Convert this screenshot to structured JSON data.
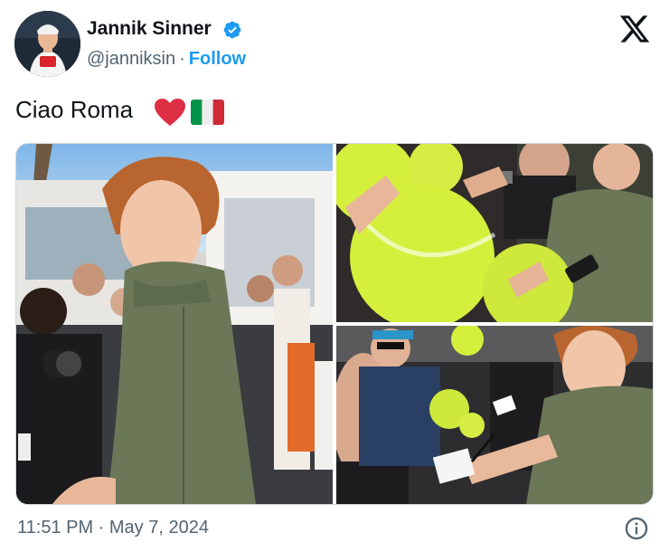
{
  "author": {
    "name": "Jannik Sinner",
    "handle": "@janniksin",
    "separator": "·",
    "follow_label": "Follow",
    "verified_icon": "verified-badge-icon"
  },
  "tweet": {
    "text": "Ciao Roma",
    "emojis": [
      "red-heart-emoji",
      "italy-flag-emoji"
    ]
  },
  "media": {
    "photo_count": 3
  },
  "footer": {
    "timestamp": "11:51 PM · May 7, 2024",
    "info_icon": "info-icon"
  },
  "brand": {
    "logo": "x-logo-icon"
  },
  "colors": {
    "link_blue": "#1d9bf0",
    "secondary_text": "#536471",
    "primary_text": "#0f1419",
    "border": "#cfd9de",
    "jacket_green": "#6b7757",
    "tennis_ball": "#d4ef3c"
  }
}
